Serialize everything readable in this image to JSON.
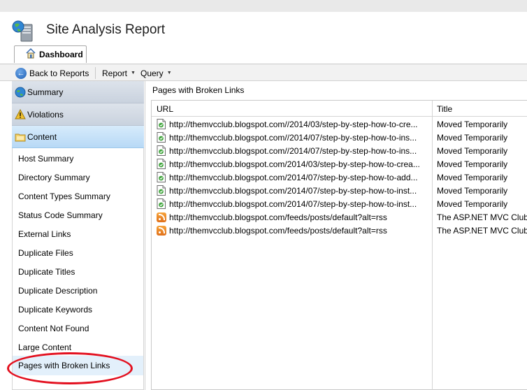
{
  "app": {
    "title": "Site Analysis Report"
  },
  "tabs": [
    {
      "label": "Dashboard"
    }
  ],
  "toolbar": {
    "back_label": "Back to Reports",
    "report_label": "Report",
    "query_label": "Query"
  },
  "sidebar": {
    "sections": [
      {
        "label": "Summary",
        "icon": "globe-icon"
      },
      {
        "label": "Violations",
        "icon": "warning-icon"
      },
      {
        "label": "Content",
        "icon": "folder-icon"
      }
    ],
    "items": [
      {
        "label": "Host Summary"
      },
      {
        "label": "Directory Summary"
      },
      {
        "label": "Content Types Summary"
      },
      {
        "label": "Status Code Summary"
      },
      {
        "label": "External Links"
      },
      {
        "label": "Duplicate Files"
      },
      {
        "label": "Duplicate Titles"
      },
      {
        "label": "Duplicate Description"
      },
      {
        "label": "Duplicate Keywords"
      },
      {
        "label": "Content Not Found"
      },
      {
        "label": "Large Content"
      },
      {
        "label": "Pages with Broken Links"
      }
    ],
    "selected": "Pages with Broken Links"
  },
  "main": {
    "panel_title": "Pages with Broken Links",
    "columns": [
      {
        "label": "URL"
      },
      {
        "label": "Title"
      }
    ],
    "rows": [
      {
        "url": "http://themvcclub.blogspot.com//2014/03/step-by-step-how-to-cre...",
        "title": "Moved Temporarily",
        "icon": "page-icon"
      },
      {
        "url": "http://themvcclub.blogspot.com//2014/07/step-by-step-how-to-ins...",
        "title": "Moved Temporarily",
        "icon": "page-icon"
      },
      {
        "url": "http://themvcclub.blogspot.com//2014/07/step-by-step-how-to-ins...",
        "title": "Moved Temporarily",
        "icon": "page-icon"
      },
      {
        "url": "http://themvcclub.blogspot.com/2014/03/step-by-step-how-to-crea...",
        "title": "Moved Temporarily",
        "icon": "page-icon"
      },
      {
        "url": "http://themvcclub.blogspot.com/2014/07/step-by-step-how-to-add...",
        "title": "Moved Temporarily",
        "icon": "page-icon"
      },
      {
        "url": "http://themvcclub.blogspot.com/2014/07/step-by-step-how-to-inst...",
        "title": "Moved Temporarily",
        "icon": "page-icon"
      },
      {
        "url": "http://themvcclub.blogspot.com/2014/07/step-by-step-how-to-inst...",
        "title": "Moved Temporarily",
        "icon": "page-icon"
      },
      {
        "url": "http://themvcclub.blogspot.com/feeds/posts/default?alt=rss",
        "title": "The ASP.NET MVC Club",
        "icon": "rss-icon"
      },
      {
        "url": "http://themvcclub.blogspot.com/feeds/posts/default?alt=rss",
        "title": "The ASP.NET MVC Club",
        "icon": "rss-icon"
      }
    ]
  },
  "colors": {
    "highlight_oval": "#e3101f",
    "section_blue": "#b8d9f6",
    "section_gray": "#c9d2de",
    "selected_item": "#e3f0fb"
  }
}
